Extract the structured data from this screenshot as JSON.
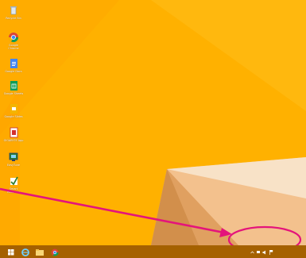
{
  "desktop": {
    "background_color": "#FFB300",
    "icons": [
      {
        "name": "recycle-bin-icon",
        "label": "Recycle Bin"
      },
      {
        "name": "chrome-icon",
        "label": "Google Chrome"
      },
      {
        "name": "docs-icon",
        "label": "Google Docs"
      },
      {
        "name": "sheets-icon",
        "label": "Google Sheets"
      },
      {
        "name": "slides-icon",
        "label": "Google Slides"
      },
      {
        "name": "red-app-icon",
        "label": "GIGABYTE App"
      },
      {
        "name": "display-app-icon",
        "label": "EasyTune"
      },
      {
        "name": "check-app-icon",
        "label": "Smart Recovery"
      }
    ]
  },
  "annotation": {
    "arrow_color": "#E4147B",
    "ellipse_color": "#E4147B"
  },
  "taskbar": {
    "color": "#A56100",
    "buttons": [
      {
        "name": "start-button-icon"
      },
      {
        "name": "internet-explorer-icon"
      },
      {
        "name": "file-explorer-icon"
      },
      {
        "name": "chrome-taskbar-icon"
      }
    ],
    "clock_time": "",
    "clock_date": ""
  }
}
